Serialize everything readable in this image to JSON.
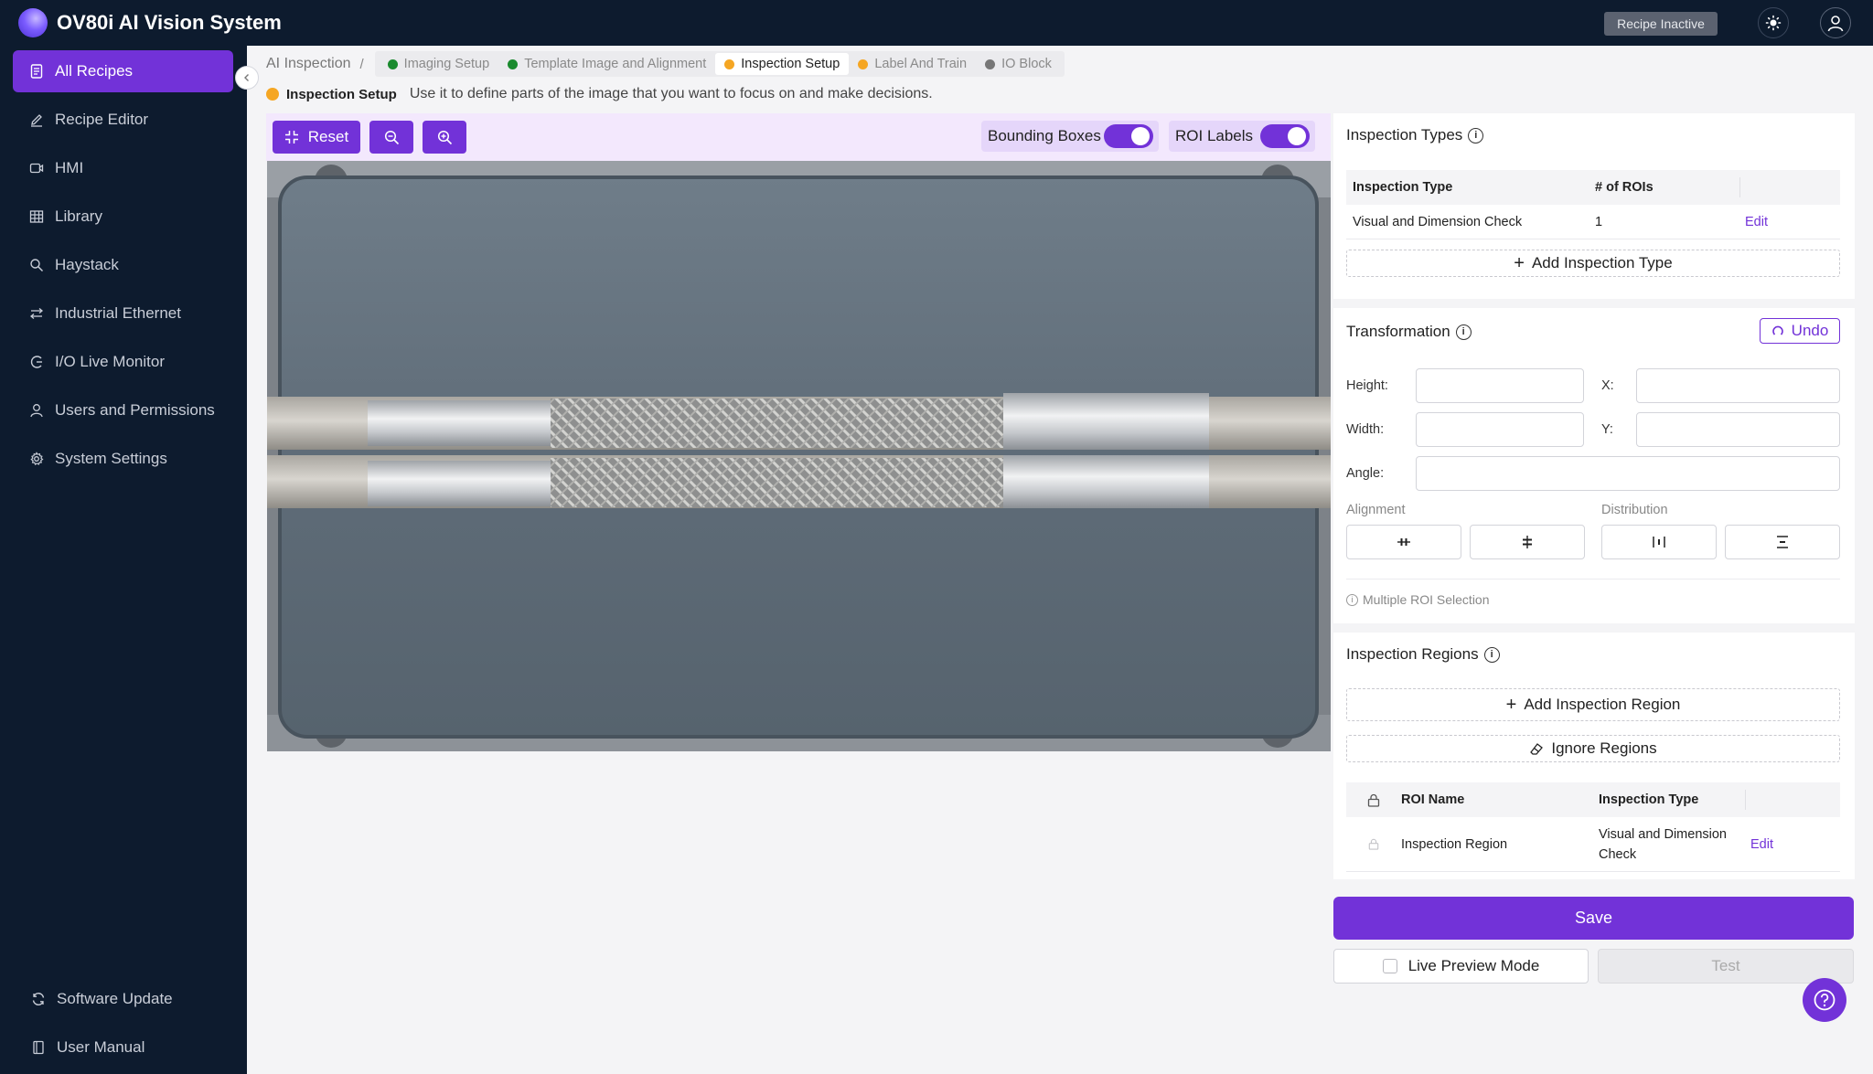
{
  "app": {
    "title": "OV80i AI Vision System",
    "recipe_status": "Recipe Inactive"
  },
  "sidebar": {
    "items": [
      {
        "label": "All Recipes",
        "icon": "document-icon",
        "active": true
      },
      {
        "label": "Recipe Editor",
        "icon": "pencil-icon"
      },
      {
        "label": "HMI",
        "icon": "video-icon"
      },
      {
        "label": "Library",
        "icon": "grid-icon"
      },
      {
        "label": "Haystack",
        "icon": "search-icon"
      },
      {
        "label": "Industrial Ethernet",
        "icon": "network-icon"
      },
      {
        "label": "I/O Live Monitor",
        "icon": "monitor-icon"
      },
      {
        "label": "Users and Permissions",
        "icon": "user-icon"
      },
      {
        "label": "System Settings",
        "icon": "gear-icon"
      }
    ],
    "footer": [
      {
        "label": "Software Update",
        "icon": "refresh-icon"
      },
      {
        "label": "User Manual",
        "icon": "book-icon"
      }
    ]
  },
  "breadcrumb": {
    "root": "AI Inspection",
    "separator": "/",
    "steps": [
      {
        "label": "Imaging Setup",
        "status_color": "#1a8a2e"
      },
      {
        "label": "Template Image and Alignment",
        "status_color": "#1a8a2e"
      },
      {
        "label": "Inspection Setup",
        "status_color": "#f5a623",
        "current": true
      },
      {
        "label": "Label And Train",
        "status_color": "#f5a623"
      },
      {
        "label": "IO Block",
        "status_color": "#777777"
      }
    ]
  },
  "info": {
    "title": "Inspection Setup",
    "text": "Use it to define parts of the image that you want to focus on and make decisions."
  },
  "toolbar": {
    "reset_label": "Reset",
    "bounding_boxes_label": "Bounding Boxes",
    "bounding_boxes_on": true,
    "roi_labels_label": "ROI Labels",
    "roi_labels_on": true
  },
  "inspection_types": {
    "title": "Inspection Types",
    "columns": [
      "Inspection Type",
      "# of ROIs",
      ""
    ],
    "rows": [
      {
        "type": "Visual and Dimension Check",
        "rois": "1",
        "action": "Edit"
      }
    ],
    "add_label": "Add Inspection Type"
  },
  "transformation": {
    "title": "Transformation",
    "undo_label": "Undo",
    "height_label": "Height:",
    "width_label": "Width:",
    "x_label": "X:",
    "y_label": "Y:",
    "angle_label": "Angle:",
    "height_value": "",
    "width_value": "",
    "x_value": "",
    "y_value": "",
    "angle_value": "",
    "alignment_label": "Alignment",
    "distribution_label": "Distribution",
    "hint": "Multiple ROI Selection"
  },
  "inspection_regions": {
    "title": "Inspection Regions",
    "add_label": "Add Inspection Region",
    "ignore_label": "Ignore Regions",
    "columns": [
      "ROI Name",
      "Inspection Type",
      ""
    ],
    "rows": [
      {
        "name": "Inspection Region",
        "type": "Visual and Dimension Check",
        "action": "Edit"
      }
    ]
  },
  "actions": {
    "save_label": "Save",
    "live_preview_label": "Live Preview Mode",
    "test_label": "Test"
  },
  "colors": {
    "accent": "#7232d8",
    "nav_bg": "#0d1b2e"
  }
}
